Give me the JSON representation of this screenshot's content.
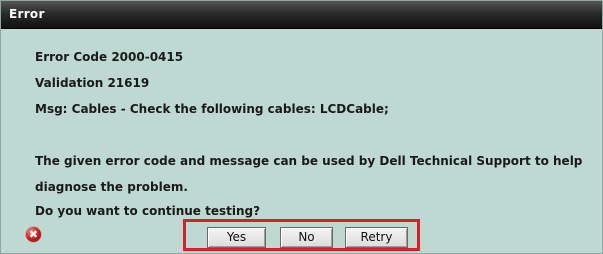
{
  "window": {
    "title": "Error"
  },
  "message": {
    "error_code": "Error Code 2000-0415",
    "validation": "Validation 21619",
    "msg": "Msg: Cables - Check the following cables: LCDCable;",
    "body_line1": "The given error code and message can be used by Dell Technical Support to help",
    "body_line2": "diagnose the problem.",
    "question": "Do you want to continue testing?"
  },
  "icon": {
    "type": "error-icon",
    "glyph": "✖",
    "color": "#d42020"
  },
  "buttons": {
    "yes_label": "Yes",
    "no_label": "No",
    "retry_label": "Retry"
  },
  "colors": {
    "dialog_background": "#bdd9d1",
    "titlebar": "#1a1a1a",
    "highlight_box": "#d8202a"
  }
}
